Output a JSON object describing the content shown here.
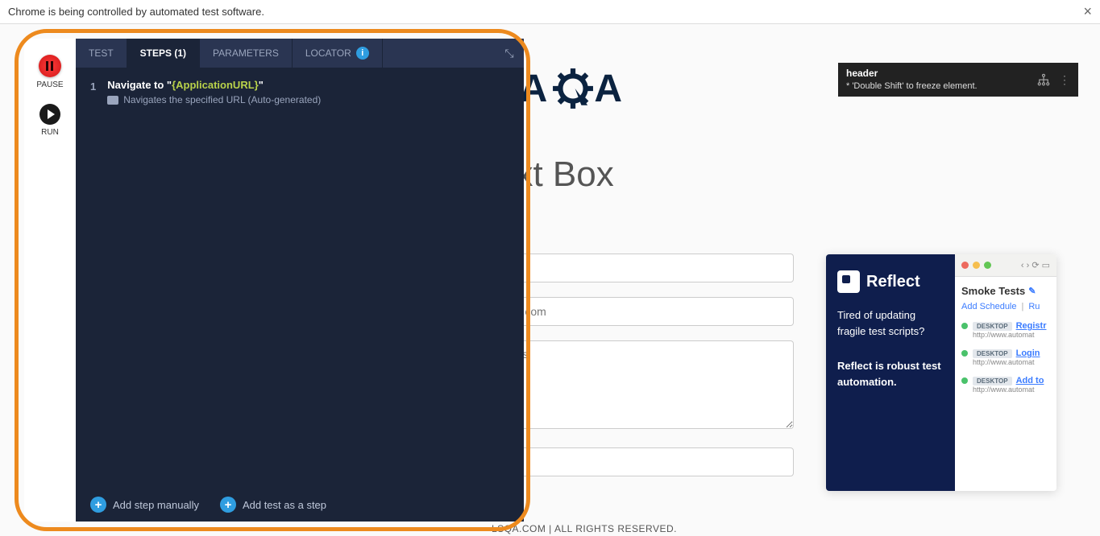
{
  "automation_notice": "Chrome is being controlled by automated test software.",
  "logo": {
    "text": "LSQA"
  },
  "page_title": "ext Box",
  "inputs": {
    "email_placeholder": "nple.com",
    "address_placeholder": "dress"
  },
  "footer_text": "LSQA.COM | ALL RIGHTS RESERVED.",
  "inspector_tip": {
    "title": "header",
    "hint": "* 'Double Shift' to freeze element."
  },
  "recorder": {
    "pause_label": "PAUSE",
    "run_label": "RUN",
    "tabs": {
      "test": "TEST",
      "steps": "STEPS (1)",
      "parameters": "PARAMETERS",
      "locator": "LOCATOR"
    },
    "steps": [
      {
        "num": "1",
        "prefix": "Navigate to \"",
        "param": "{ApplicationURL}",
        "suffix": "\"",
        "desc": "Navigates the specified URL (Auto-generated)"
      }
    ],
    "add_manual": "Add step manually",
    "add_test": "Add test as a step"
  },
  "ad": {
    "brand": "Reflect",
    "tagline1": "Tired of updating fragile test scripts?",
    "tagline2": "Reflect is robust test automation.",
    "window_title": "Smoke Tests",
    "add_schedule": "Add Schedule",
    "run_label": "Ru",
    "desktop_badge": "DESKTOP",
    "tests": [
      {
        "name": "Registr",
        "url": "http://www.automat"
      },
      {
        "name": "Login",
        "url": "http://www.automat"
      },
      {
        "name": "Add to",
        "url": "http://www.automat"
      }
    ]
  }
}
